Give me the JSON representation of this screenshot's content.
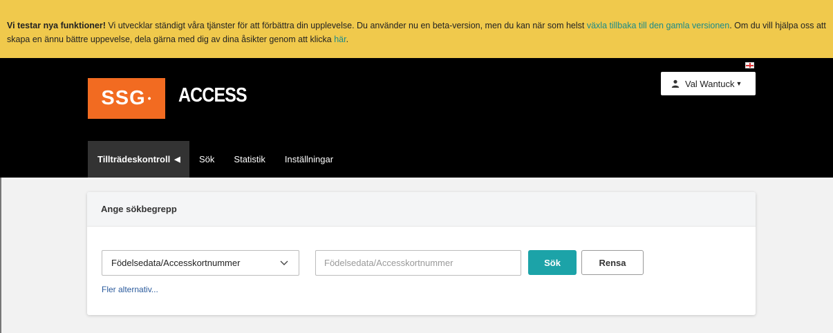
{
  "banner": {
    "lead": "Vi testar nya funktioner!",
    "text1": " Vi utvecklar ständigt våra tjänster för att förbättra din upplevelse. Du använder nu en beta-version, men du kan när som helst ",
    "switch_link": "växla tillbaka till den gamla versionen",
    "text2": ". Om du vill hjälpa oss att skapa en ännu bättre uppevelse, dela gärna med dig av dina åsikter genom att klicka ",
    "here_link": "här",
    "text3": "."
  },
  "header": {
    "logo_text": "SSG",
    "logo_dot": "•",
    "app_title": "ACCESS",
    "user_name": "Val Wantuck",
    "language_icon": "uk-flag-icon"
  },
  "nav": {
    "items": [
      {
        "label": "Tillträdeskontroll",
        "active": true
      },
      {
        "label": "Sök"
      },
      {
        "label": "Statistik"
      },
      {
        "label": "Inställningar"
      }
    ]
  },
  "search_card": {
    "title": "Ange sökbegrepp",
    "type_selected": "Födelsedata/Accesskortnummer",
    "input_value": "",
    "input_placeholder": "Födelsedata/Accesskortnummer",
    "search_label": "Sök",
    "clear_label": "Rensa",
    "more_options": "Fler alternativ..."
  },
  "colors": {
    "banner_bg": "#f0c94c",
    "header_bg": "#000000",
    "brand_orange": "#f26b21",
    "accent_teal": "#1ca3a8",
    "link_teal": "#1a8a8a"
  }
}
